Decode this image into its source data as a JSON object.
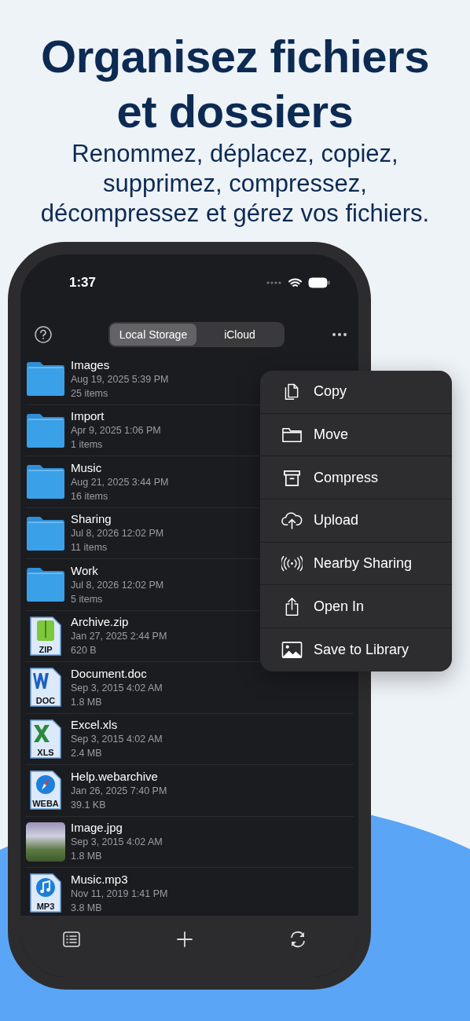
{
  "headline_lines": [
    "Organisez fichiers",
    "et dossiers"
  ],
  "subtitle_lines": [
    "Renommez, déplacez, copiez,",
    "supprimez, compressez,",
    "décompressez et gérez vos fichiers."
  ],
  "status_bar": {
    "time": "1:37"
  },
  "tabs": [
    {
      "label": "Local Storage",
      "selected": true
    },
    {
      "label": "iCloud",
      "selected": false
    }
  ],
  "files": [
    {
      "kind": "folder",
      "name": "Images",
      "date": "Aug 19, 2025 5:39 PM",
      "info": "25 items"
    },
    {
      "kind": "folder",
      "name": "Import",
      "date": "Apr 9, 2025 1:06 PM",
      "info": "1 items"
    },
    {
      "kind": "folder",
      "name": "Music",
      "date": "Aug 21, 2025 3:44 PM",
      "info": "16 items"
    },
    {
      "kind": "folder",
      "name": "Sharing",
      "date": "Jul 8, 2026 12:02 PM",
      "info": "11 items"
    },
    {
      "kind": "folder",
      "name": "Work",
      "date": "Jul 8, 2026 12:02 PM",
      "info": "5 items"
    },
    {
      "kind": "zip",
      "badge": "ZIP",
      "name": "Archive.zip",
      "date": "Jan 27, 2025 2:44 PM",
      "info": "620 B"
    },
    {
      "kind": "doc",
      "badge": "DOC",
      "name": "Document.doc",
      "date": "Sep 3, 2015 4:02 AM",
      "info": "1.8 MB"
    },
    {
      "kind": "xls",
      "badge": "XLS",
      "name": "Excel.xls",
      "date": "Sep 3, 2015 4:02 AM",
      "info": "2.4 MB"
    },
    {
      "kind": "weba",
      "badge": "WEBA",
      "name": "Help.webarchive",
      "date": "Jan 26, 2025 7:40 PM",
      "info": "39.1 KB"
    },
    {
      "kind": "image",
      "name": "Image.jpg",
      "date": "Sep 3, 2015 4:02 AM",
      "info": "1.8 MB"
    },
    {
      "kind": "mp3",
      "badge": "MP3",
      "name": "Music.mp3",
      "date": "Nov 11, 2019 1:41 PM",
      "info": "3.8 MB"
    }
  ],
  "menu": [
    {
      "kind": "copy",
      "label": "Copy"
    },
    {
      "kind": "move",
      "label": "Move"
    },
    {
      "kind": "compress",
      "label": "Compress"
    },
    {
      "kind": "upload",
      "label": "Upload"
    },
    {
      "kind": "nearby",
      "label": "Nearby Sharing"
    },
    {
      "kind": "open",
      "label": "Open In"
    },
    {
      "kind": "save",
      "label": "Save to Library"
    }
  ]
}
